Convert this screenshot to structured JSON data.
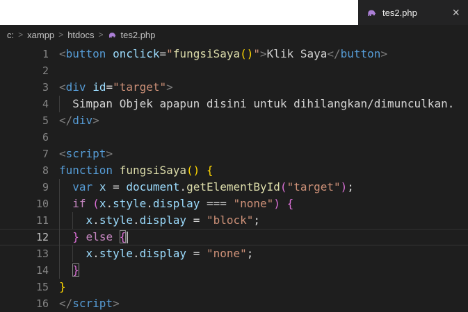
{
  "tab": {
    "label": "tes2.php",
    "close_glyph": "×",
    "icon": "php-elephant",
    "icon_color": "#ab7fd6"
  },
  "breadcrumb": {
    "separator": ">",
    "items": [
      "c:",
      "xampp",
      "htdocs",
      "tes2.php"
    ],
    "file_icon_color": "#ab7fd6"
  },
  "editor": {
    "background": "#1e1e1e",
    "palette": {
      "punct": "#808080",
      "tag": "#569cd6",
      "attr": "#9cdcfe",
      "def": "#d4d4d4",
      "str": "#ce9178",
      "kw": "#569cd6",
      "ctrl": "#c586c0",
      "fn": "#dcdcaa",
      "b1": "#ffd700",
      "b2": "#da70d6"
    },
    "lines": [
      {
        "n": "1",
        "tokens": [
          {
            "c": "punct",
            "t": "<"
          },
          {
            "c": "tag",
            "t": "button"
          },
          {
            "c": "def",
            "t": " "
          },
          {
            "c": "attr",
            "t": "onclick"
          },
          {
            "c": "def",
            "t": "="
          },
          {
            "c": "str",
            "t": "\""
          },
          {
            "c": "fn",
            "t": "fungsiSaya"
          },
          {
            "c": "b1",
            "t": "()"
          },
          {
            "c": "str",
            "t": "\""
          },
          {
            "c": "punct",
            "t": ">"
          },
          {
            "c": "def",
            "t": "Klik Saya"
          },
          {
            "c": "punct",
            "t": "</"
          },
          {
            "c": "tag",
            "t": "button"
          },
          {
            "c": "punct",
            "t": ">"
          }
        ]
      },
      {
        "n": "2",
        "tokens": []
      },
      {
        "n": "3",
        "tokens": [
          {
            "c": "punct",
            "t": "<"
          },
          {
            "c": "tag",
            "t": "div"
          },
          {
            "c": "def",
            "t": " "
          },
          {
            "c": "attr",
            "t": "id"
          },
          {
            "c": "def",
            "t": "="
          },
          {
            "c": "str",
            "t": "\"target\""
          },
          {
            "c": "punct",
            "t": ">"
          }
        ]
      },
      {
        "n": "4",
        "guides": [
          0
        ],
        "tokens": [
          {
            "c": "def",
            "t": "  Simpan Objek apapun disini untuk dihilangkan/dimunculkan."
          }
        ]
      },
      {
        "n": "5",
        "tokens": [
          {
            "c": "punct",
            "t": "</"
          },
          {
            "c": "tag",
            "t": "div"
          },
          {
            "c": "punct",
            "t": ">"
          }
        ]
      },
      {
        "n": "6",
        "tokens": []
      },
      {
        "n": "7",
        "tokens": [
          {
            "c": "punct",
            "t": "<"
          },
          {
            "c": "tag",
            "t": "script"
          },
          {
            "c": "punct",
            "t": ">"
          }
        ]
      },
      {
        "n": "8",
        "tokens": [
          {
            "c": "kw",
            "t": "function"
          },
          {
            "c": "def",
            "t": " "
          },
          {
            "c": "fn",
            "t": "fungsiSaya"
          },
          {
            "c": "b1",
            "t": "()"
          },
          {
            "c": "def",
            "t": " "
          },
          {
            "c": "b1",
            "t": "{"
          }
        ]
      },
      {
        "n": "9",
        "guides": [
          0
        ],
        "tokens": [
          {
            "c": "def",
            "t": "  "
          },
          {
            "c": "kw",
            "t": "var"
          },
          {
            "c": "def",
            "t": " "
          },
          {
            "c": "attr",
            "t": "x"
          },
          {
            "c": "def",
            "t": " = "
          },
          {
            "c": "attr",
            "t": "document"
          },
          {
            "c": "def",
            "t": "."
          },
          {
            "c": "fn",
            "t": "getElementById"
          },
          {
            "c": "b2",
            "t": "("
          },
          {
            "c": "str",
            "t": "\"target\""
          },
          {
            "c": "b2",
            "t": ")"
          },
          {
            "c": "def",
            "t": ";"
          }
        ]
      },
      {
        "n": "10",
        "guides": [
          0
        ],
        "tokens": [
          {
            "c": "def",
            "t": "  "
          },
          {
            "c": "ctrl",
            "t": "if"
          },
          {
            "c": "def",
            "t": " "
          },
          {
            "c": "b2",
            "t": "("
          },
          {
            "c": "attr",
            "t": "x"
          },
          {
            "c": "def",
            "t": "."
          },
          {
            "c": "attr",
            "t": "style"
          },
          {
            "c": "def",
            "t": "."
          },
          {
            "c": "attr",
            "t": "display"
          },
          {
            "c": "def",
            "t": " === "
          },
          {
            "c": "str",
            "t": "\"none\""
          },
          {
            "c": "b2",
            "t": ")"
          },
          {
            "c": "def",
            "t": " "
          },
          {
            "c": "b2",
            "t": "{"
          }
        ]
      },
      {
        "n": "11",
        "guides": [
          0,
          1
        ],
        "tokens": [
          {
            "c": "def",
            "t": "    "
          },
          {
            "c": "attr",
            "t": "x"
          },
          {
            "c": "def",
            "t": "."
          },
          {
            "c": "attr",
            "t": "style"
          },
          {
            "c": "def",
            "t": "."
          },
          {
            "c": "attr",
            "t": "display"
          },
          {
            "c": "def",
            "t": " = "
          },
          {
            "c": "str",
            "t": "\"block\""
          },
          {
            "c": "def",
            "t": ";"
          }
        ]
      },
      {
        "n": "12",
        "active": true,
        "cursor": true,
        "guides": [
          0
        ],
        "tokens": [
          {
            "c": "def",
            "t": "  "
          },
          {
            "c": "b2",
            "t": "}"
          },
          {
            "c": "def",
            "t": " "
          },
          {
            "c": "ctrl",
            "t": "else"
          },
          {
            "c": "def",
            "t": " "
          },
          {
            "c": "b2",
            "t": "{",
            "box": true
          }
        ]
      },
      {
        "n": "13",
        "guides": [
          0,
          1
        ],
        "tokens": [
          {
            "c": "def",
            "t": "    "
          },
          {
            "c": "attr",
            "t": "x"
          },
          {
            "c": "def",
            "t": "."
          },
          {
            "c": "attr",
            "t": "style"
          },
          {
            "c": "def",
            "t": "."
          },
          {
            "c": "attr",
            "t": "display"
          },
          {
            "c": "def",
            "t": " = "
          },
          {
            "c": "str",
            "t": "\"none\""
          },
          {
            "c": "def",
            "t": ";"
          }
        ]
      },
      {
        "n": "14",
        "guides": [
          0
        ],
        "tokens": [
          {
            "c": "def",
            "t": "  "
          },
          {
            "c": "b2",
            "t": "}",
            "box": true
          }
        ]
      },
      {
        "n": "15",
        "tokens": [
          {
            "c": "b1",
            "t": "}"
          }
        ]
      },
      {
        "n": "16",
        "tokens": [
          {
            "c": "punct",
            "t": "</"
          },
          {
            "c": "tag",
            "t": "script"
          },
          {
            "c": "punct",
            "t": ">"
          }
        ]
      }
    ]
  }
}
